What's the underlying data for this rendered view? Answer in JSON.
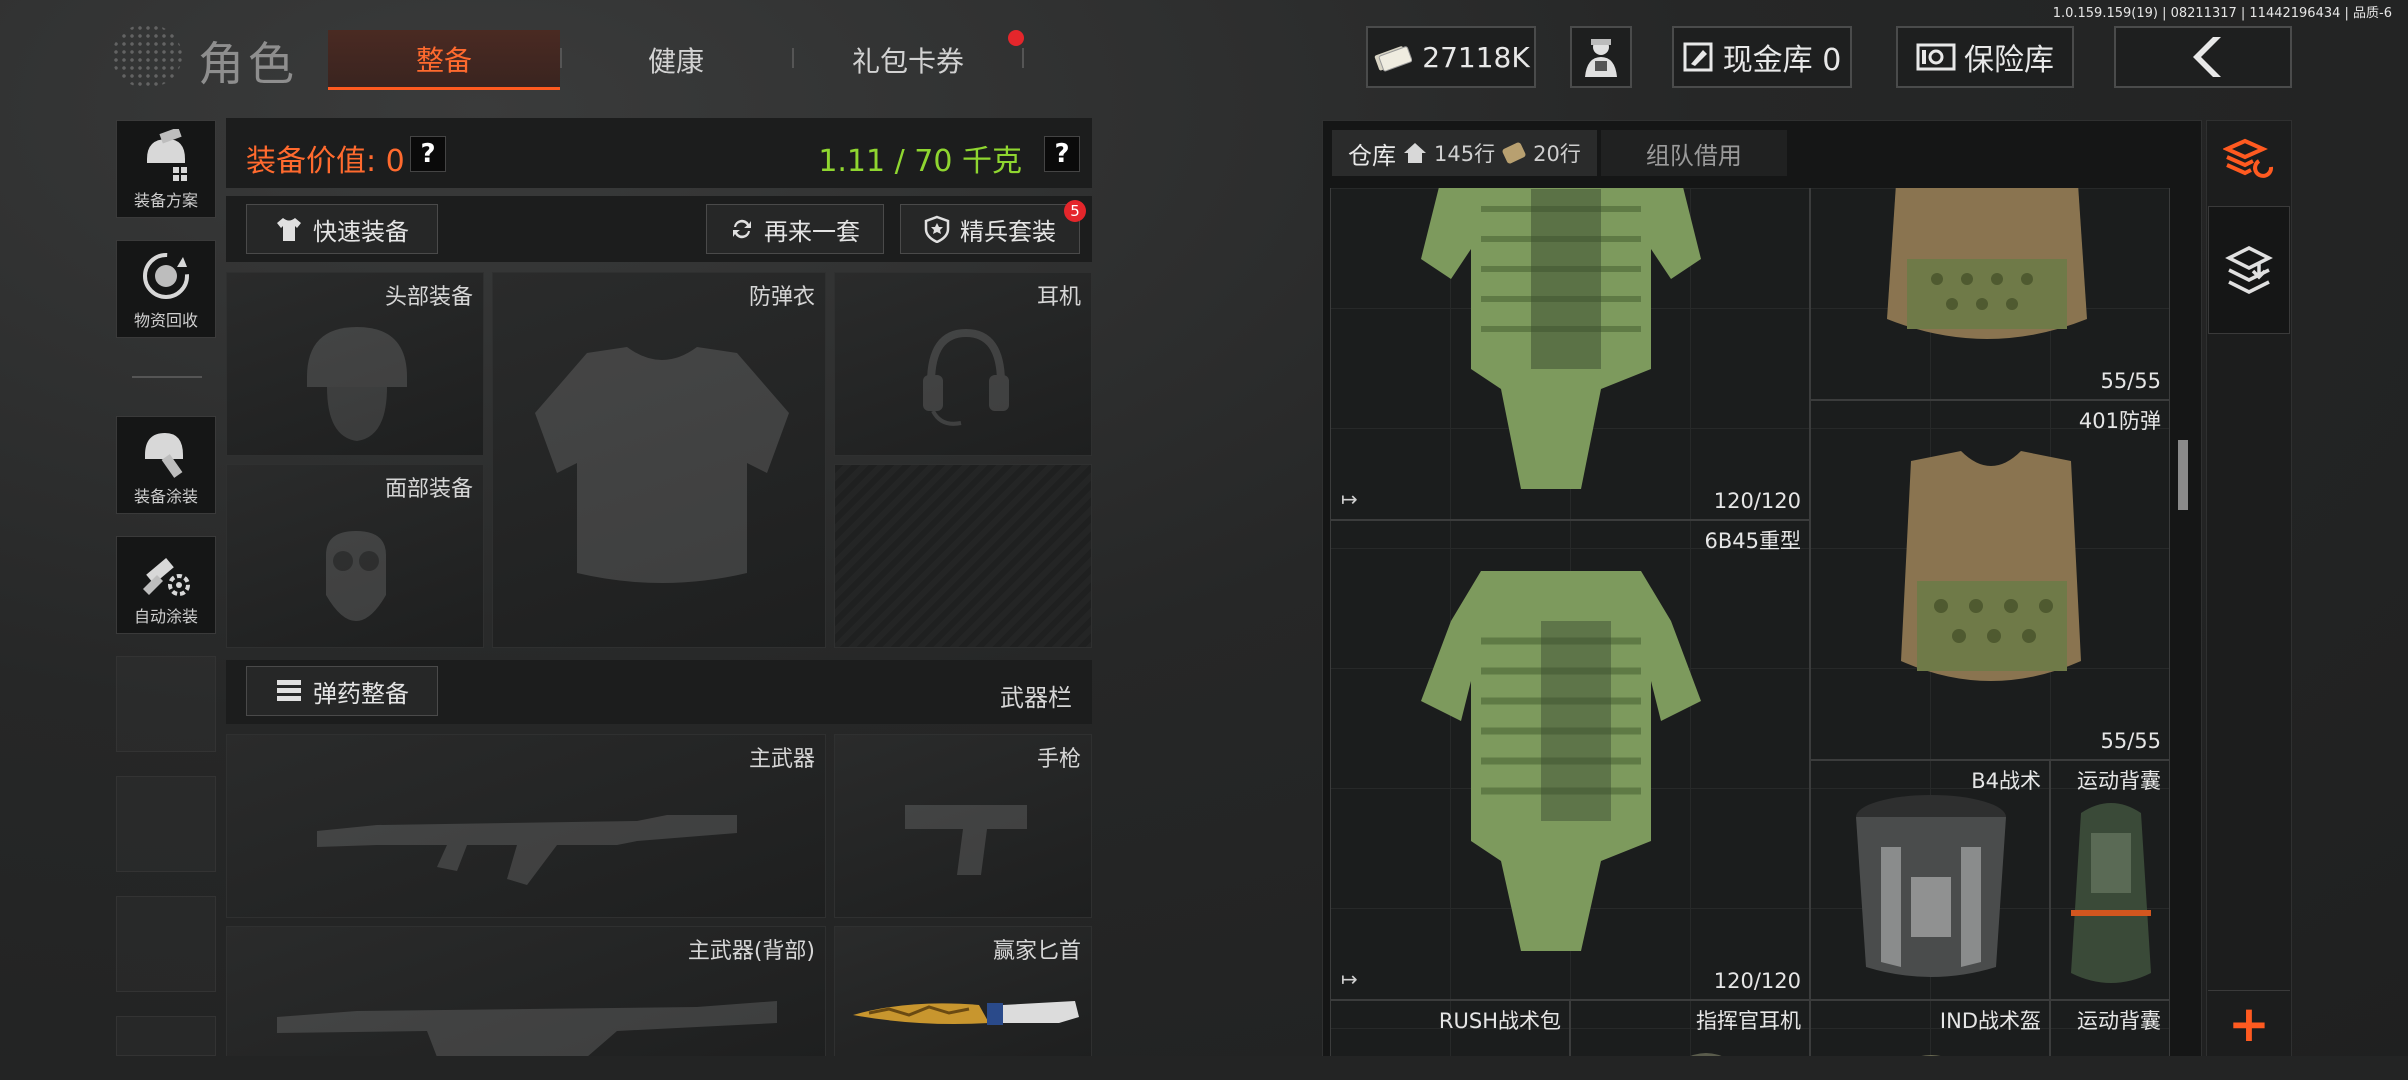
{
  "version": "1.0.159.159(19) | 08211317 | 11442196434 | 品质-6",
  "header": {
    "title": "角色",
    "tabs": [
      {
        "label": "整备",
        "active": true
      },
      {
        "label": "健康",
        "active": false
      },
      {
        "label": "礼包卡券",
        "active": false,
        "notification": true
      }
    ],
    "currency": "27118K",
    "cash_vault": "现金库 0",
    "insurance": "保险库"
  },
  "sidebar": {
    "items": [
      {
        "label": "装备方案",
        "icon": "helmet-plan-icon"
      },
      {
        "label": "物资回收",
        "icon": "recycle-icon"
      },
      {
        "label": "装备涂装",
        "icon": "paint-helmet-icon"
      },
      {
        "label": "自动涂装",
        "icon": "auto-paint-icon"
      }
    ]
  },
  "equipment": {
    "value_label": "装备价值: 0",
    "weight_label": "1.11 / 70 千克",
    "quick_equip": "快速装备",
    "reroll": "再来一套",
    "elite_set": "精兵套装",
    "elite_badge": "5",
    "ammo_button": "弹药整备",
    "weapon_column": "武器栏",
    "slots": {
      "head": "头部装备",
      "armor": "防弹衣",
      "headset": "耳机",
      "face": "面部装备",
      "primary": "主武器",
      "pistol": "手枪",
      "primary_back": "主武器(背部)",
      "melee": "赢家匕首"
    }
  },
  "warehouse": {
    "tab_label": "仓库",
    "rows_home": "145行",
    "rows_ticket": "20行",
    "team_tab": "组队借用",
    "items": [
      {
        "name": "",
        "durability": "120/120",
        "out": true
      },
      {
        "name": "",
        "durability": "55/55"
      },
      {
        "name": "401防弹",
        "durability": "55/55"
      },
      {
        "name": "6B45重型",
        "durability": "120/120",
        "out": true
      },
      {
        "name": "B4战术",
        "durability": ""
      },
      {
        "name": "运动背囊",
        "durability": ""
      },
      {
        "name": "RUSH战术包",
        "durability": ""
      },
      {
        "name": "指挥官耳机",
        "durability": ""
      },
      {
        "name": "IND战术盔",
        "durability": ""
      },
      {
        "name": "运动背囊",
        "durability": ""
      }
    ]
  },
  "colors": {
    "accent": "#ff5a20",
    "weight_green": "#8fd630",
    "badge_red": "#e4262b"
  }
}
